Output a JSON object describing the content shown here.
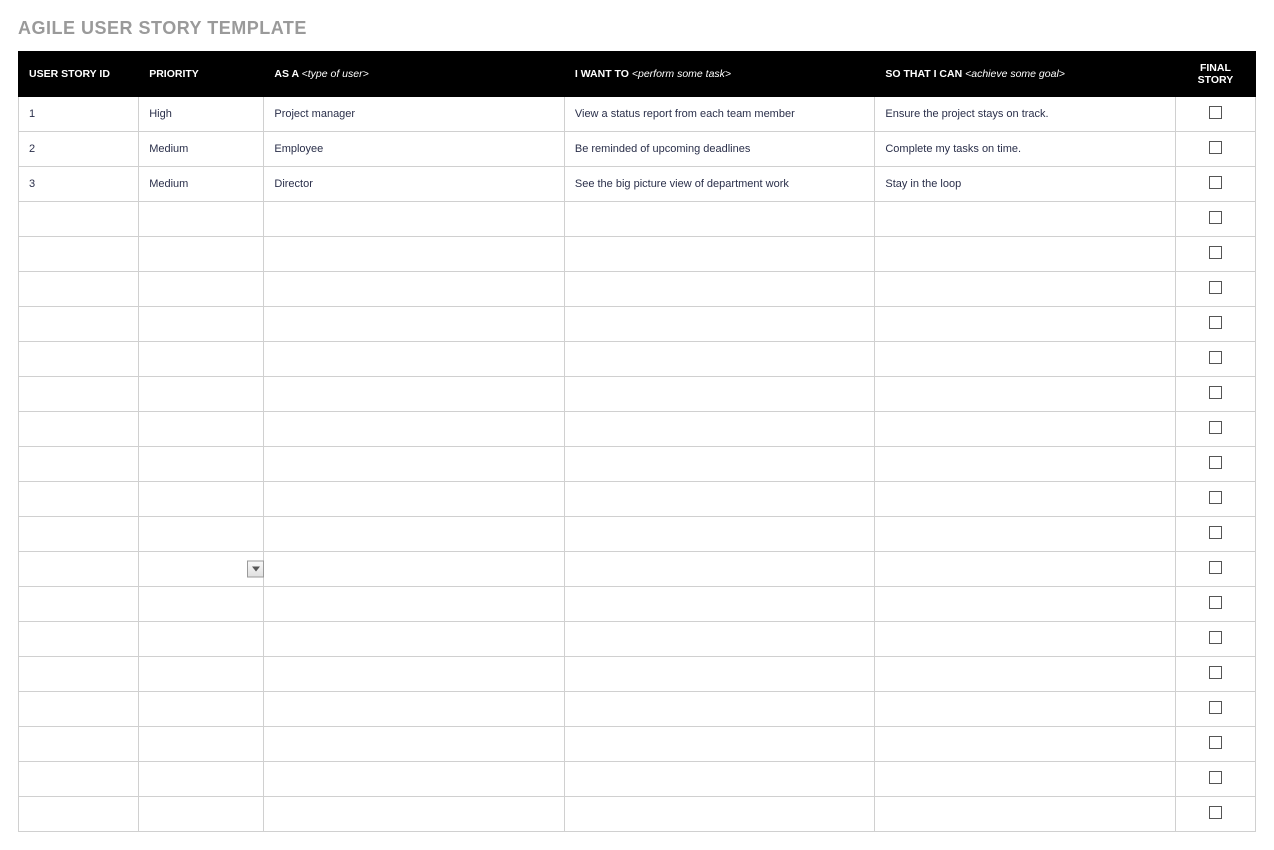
{
  "title": "AGILE USER STORY TEMPLATE",
  "headers": {
    "id": "USER STORY ID",
    "priority": "PRIORITY",
    "asa_prefix": "AS A ",
    "asa_hint": "<type of user>",
    "iwant_prefix": "I WANT TO ",
    "iwant_hint": "<perform some task>",
    "sothat_prefix": "SO THAT I CAN ",
    "sothat_hint": "<achieve some goal>",
    "final": "FINAL STORY"
  },
  "rows": [
    {
      "id": "1",
      "priority": "High",
      "asa": "Project manager",
      "iwant": "View a status report from each team member",
      "sothat": "Ensure the project stays on track."
    },
    {
      "id": "2",
      "priority": "Medium",
      "asa": "Employee",
      "iwant": "Be reminded of upcoming deadlines",
      "sothat": "Complete my tasks on time."
    },
    {
      "id": "3",
      "priority": "Medium",
      "asa": "Director",
      "iwant": "See the big picture view of department work",
      "sothat": "Stay in the loop"
    },
    {
      "id": "",
      "priority": "",
      "asa": "",
      "iwant": "",
      "sothat": ""
    },
    {
      "id": "",
      "priority": "",
      "asa": "",
      "iwant": "",
      "sothat": ""
    },
    {
      "id": "",
      "priority": "",
      "asa": "",
      "iwant": "",
      "sothat": ""
    },
    {
      "id": "",
      "priority": "",
      "asa": "",
      "iwant": "",
      "sothat": ""
    },
    {
      "id": "",
      "priority": "",
      "asa": "",
      "iwant": "",
      "sothat": ""
    },
    {
      "id": "",
      "priority": "",
      "asa": "",
      "iwant": "",
      "sothat": ""
    },
    {
      "id": "",
      "priority": "",
      "asa": "",
      "iwant": "",
      "sothat": ""
    },
    {
      "id": "",
      "priority": "",
      "asa": "",
      "iwant": "",
      "sothat": ""
    },
    {
      "id": "",
      "priority": "",
      "asa": "",
      "iwant": "",
      "sothat": ""
    },
    {
      "id": "",
      "priority": "",
      "asa": "",
      "iwant": "",
      "sothat": ""
    },
    {
      "id": "",
      "priority": "",
      "asa": "",
      "iwant": "",
      "sothat": "",
      "showDropdown": true
    },
    {
      "id": "",
      "priority": "",
      "asa": "",
      "iwant": "",
      "sothat": ""
    },
    {
      "id": "",
      "priority": "",
      "asa": "",
      "iwant": "",
      "sothat": ""
    },
    {
      "id": "",
      "priority": "",
      "asa": "",
      "iwant": "",
      "sothat": ""
    },
    {
      "id": "",
      "priority": "",
      "asa": "",
      "iwant": "",
      "sothat": ""
    },
    {
      "id": "",
      "priority": "",
      "asa": "",
      "iwant": "",
      "sothat": ""
    },
    {
      "id": "",
      "priority": "",
      "asa": "",
      "iwant": "",
      "sothat": ""
    },
    {
      "id": "",
      "priority": "",
      "asa": "",
      "iwant": "",
      "sothat": ""
    }
  ]
}
